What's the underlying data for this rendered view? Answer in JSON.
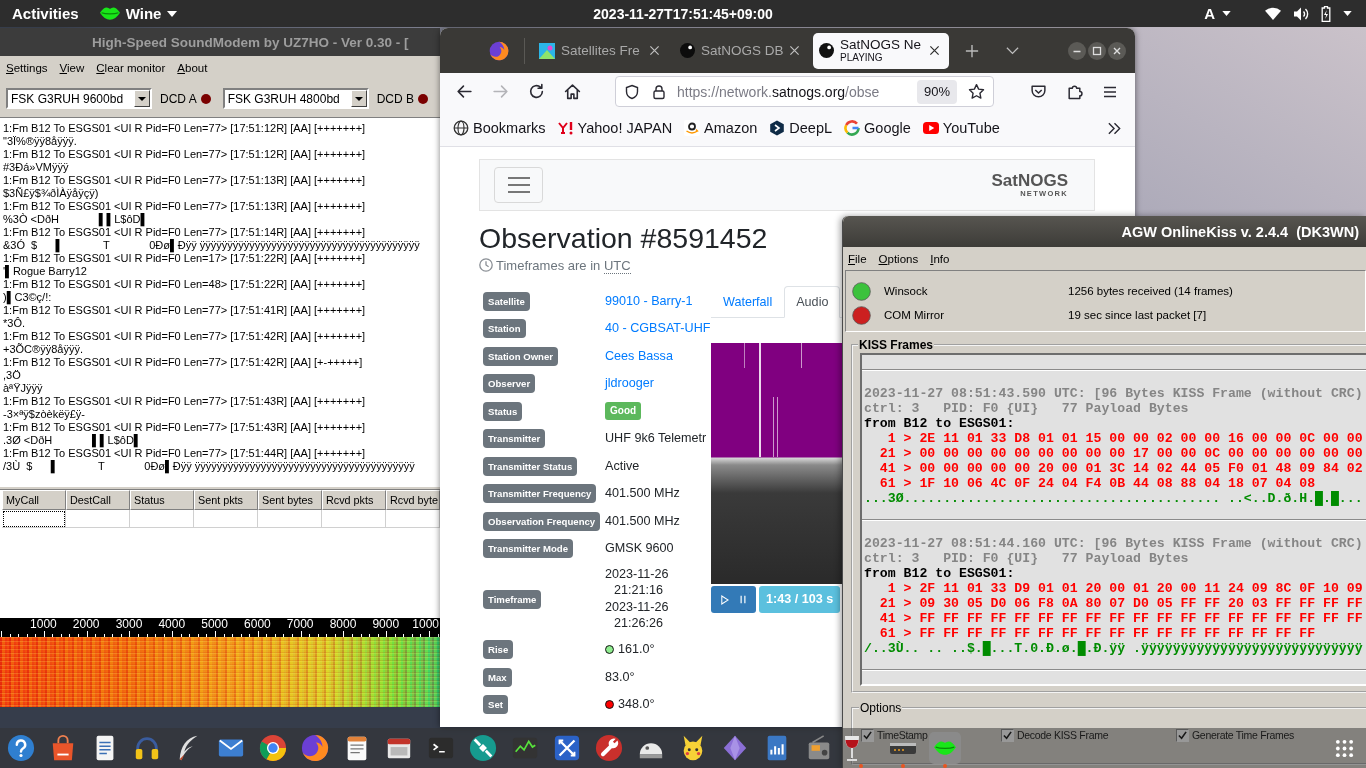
{
  "top_bar": {
    "activities": "Activities",
    "app_name": "Wine",
    "clock": "2023-11-27T17:51:45+09:00",
    "input_source": "A"
  },
  "soundmodem": {
    "title": "High-Speed SoundModem by UZ7HO - Ver 0.30 - [",
    "menu": [
      "Settings",
      "View",
      "Clear monitor",
      "About"
    ],
    "channels": [
      {
        "mode": "FSK G3RUH 9600bd",
        "dcd_label": "DCD A"
      },
      {
        "mode": "FSK G3RUH 4800bd",
        "dcd_label": "DCD B"
      }
    ],
    "monitor_lines": [
      "1:Fm B12 To ESGS01 <UI R Pid=F0 Len=77> [17:51:12R] [AA] [+++++++]",
      "\"3Ï%®ÿÿ8åÿÿÿ.",
      "1:Fm B12 To ESGS01 <UI R Pid=F0 Len=77> [17:51:12R] [AA] [+++++++]",
      "#3Ðá»VMÿÿÿ",
      "1:Fm B12 To ESGS01 <UI R Pid=F0 Len=77> [17:51:13R] [AA] [+++++++]",
      "$3Ñ£ÿ$¾ðÌÀÿåÿçÿ)",
      "1:Fm B12 To ESGS01 <UI R Pid=F0 Len=77> [17:51:13R] [AA] [+++++++]",
      "%3Ò <DðH             ▌▌L$ôD▌",
      "1:Fm B12 To ESGS01 <UI R Pid=F0 Len=77> [17:51:14R] [AA] [+++++++]",
      "&3Ó  $      ▌             T             0Ðø▌Ðÿÿ ÿÿÿÿÿÿÿÿÿÿÿÿÿÿÿÿÿÿÿÿÿÿÿÿÿÿÿÿÿÿÿÿÿÿÿÿÿÿÿÿ",
      "1:Fm B12 To ESGS01 <UI R Pid=F0 Len=17> [17:51:22R] [AA] [+++++++]",
      "'▌Rogue Barry12",
      "1:Fm B12 To ESGS01 <UI R Pid=F0 Len=48> [17:51:22R] [AA] [+++++++]",
      ")▌C3©ç/!:",
      "1:Fm B12 To ESGS01 <UI R Pid=F0 Len=77> [17:51:41R] [AA] [+++++++]",
      "*3Ô.",
      "1:Fm B12 To ESGS01 <UI R Pid=F0 Len=77> [17:51:42R] [AA] [+++++++]",
      "+3ÕC®ÿÿ8åÿÿÿ.",
      "1:Fm B12 To ESGS01 <UI R Pid=F0 Len=77> [17:51:42R] [AA] [+-+++++]",
      ",3Ö",
      "àªŸJÿÿÿ",
      "1:Fm B12 To ESGS01 <UI R Pid=F0 Len=77> [17:51:43R] [AA] [+++++++]",
      "-3×ªÿ$zòèkëÿ£ÿ-",
      "1:Fm B12 To ESGS01 <UI R Pid=F0 Len=77> [17:51:43R] [AA] [+++++++]",
      ".3Ø <DðH             ▌▌L$ôD▌",
      "1:Fm B12 To ESGS01 <UI R Pid=F0 Len=77> [17:51:44R] [AA] [+++++++]",
      "/3Ù  $      ▌             T             0Ðø▌Ðÿÿ ÿÿÿÿÿÿÿÿÿÿÿÿÿÿÿÿÿÿÿÿÿÿÿÿÿÿÿÿÿÿÿÿÿÿÿÿÿÿÿÿ"
    ],
    "table": {
      "columns": [
        {
          "label": "MyCall",
          "focused": true
        },
        {
          "label": "DestCall",
          "focused": false
        },
        {
          "label": "Status",
          "focused": false
        },
        {
          "label": "Sent pkts",
          "focused": false
        },
        {
          "label": "Sent bytes",
          "focused": false
        },
        {
          "label": "Rcvd pkts",
          "focused": false
        },
        {
          "label": "Rcvd byte",
          "focused": false
        }
      ]
    },
    "waterfall_scale": [
      "1000",
      "2000",
      "3000",
      "4000",
      "5000",
      "6000",
      "7000",
      "8000",
      "9000",
      "1000"
    ]
  },
  "browser": {
    "tabs": [
      {
        "title": "Satellites Fre",
        "selected": false
      },
      {
        "title": "SatNOGS DB",
        "selected": false
      },
      {
        "title": "SatNOGS Ne",
        "subtitle": "PLAYING",
        "selected": true
      }
    ],
    "nav_buttons": [
      {
        "disabled": false
      },
      {
        "disabled": true
      },
      {
        "disabled": false
      },
      {
        "disabled": false
      }
    ],
    "url": {
      "prefix": "https://network.",
      "domain": "satnogs.org",
      "suffix": "/obse"
    },
    "zoom": "90%",
    "bookmarks": [
      "Bookmarks",
      "Yahoo! JAPAN",
      "Amazon",
      "DeepL",
      "Google",
      "YouTube"
    ],
    "page": {
      "logo": {
        "name": "SatNOGS",
        "sub": "NETWORK"
      },
      "title": "Observation #8591452",
      "tz_note": "Timeframes are in ",
      "tz": "UTC",
      "details": [
        {
          "label": "Satellite",
          "kind": "link",
          "value": "99010 - Barry-1"
        },
        {
          "label": "Station",
          "kind": "link",
          "value": "40 - CGBSAT-UHF"
        },
        {
          "label": "Station Owner",
          "kind": "link",
          "value": "Cees Bassa"
        },
        {
          "label": "Observer",
          "kind": "link",
          "value": "jldrooger"
        },
        {
          "label": "Status",
          "kind": "badge",
          "value": "Good"
        },
        {
          "label": "Transmitter",
          "kind": "text",
          "value": "UHF 9k6 Telemetr"
        },
        {
          "label": "Transmitter Status",
          "kind": "text",
          "value": "Active"
        },
        {
          "label": "Transmitter Frequency",
          "kind": "text",
          "value": "401.500 MHz"
        },
        {
          "label": "Observation Frequency",
          "kind": "text",
          "value": "401.500 MHz"
        },
        {
          "label": "Transmitter Mode",
          "kind": "text",
          "value": "GMSK 9600"
        },
        {
          "label": "Timeframe",
          "kind": "lines",
          "values": [
            "2023-11-26 21:21:16",
            "2023-11-26 21:26:26"
          ]
        },
        {
          "label": "Rise",
          "kind": "dot",
          "color": "#90ee90",
          "value": "161.0°"
        },
        {
          "label": "Max",
          "kind": "text",
          "value": "83.0°"
        },
        {
          "label": "Set",
          "kind": "dot",
          "color": "#ff0000",
          "value": "348.0°"
        }
      ],
      "media_tabs": [
        {
          "label": "Waterfall",
          "selected": false
        },
        {
          "label": "Audio",
          "selected": true
        }
      ],
      "player": {
        "time": "1:43 / 103 s"
      }
    }
  },
  "agw": {
    "title": "AGW OnlineKiss v. 2.4.4  (DK3WN)",
    "menu": [
      "File",
      "Options",
      "Info"
    ],
    "connections": [
      {
        "name": "Winsock",
        "info": "1256 bytes received (14 frames)",
        "color": "#3cc23c"
      },
      {
        "name": "COM Mirror",
        "info": "19 sec since last packet [7]",
        "color": "#cc2020"
      }
    ],
    "frames_title": "KISS Frames",
    "frames": [
      {
        "header": "2023-11-27 08:51:43.590 UTC: [96 Bytes KISS Frame (without CRC)",
        "info": "ctrl: 3   PID: F0 {UI}   77 Payload Bytes",
        "route": "from B12 to ESGS01:",
        "hex_lines": [
          "   1 > 2E 11 01 33 D8 01 01 15 00 00 02 00 00 16 00 00 0C 00 00",
          "  21 > 00 00 00 00 00 00 00 00 00 17 00 00 0C 00 00 00 00 00 00",
          "  41 > 00 00 00 00 00 20 00 01 3C 14 02 44 05 F0 01 48 09 84 02",
          "  61 > 1F 10 06 4C 0F 24 04 F4 0B 44 08 88 04 18 07 04 08"
        ],
        "ascii": "...3Ø........................................ ..<..D.ð.H.█.█..."
      },
      {
        "header": "2023-11-27 08:51:44.160 UTC: [96 Bytes KISS Frame (without CRC)",
        "info": "ctrl: 3   PID: F0 {UI}   77 Payload Bytes",
        "route": "from B12 to ESGS01:",
        "hex_lines": [
          "   1 > 2F 11 01 33 D9 01 01 20 00 01 20 00 11 24 09 8C 0F 10 09",
          "  21 > 09 30 05 D0 06 F8 0A 80 07 D0 05 FF FF 20 03 FF FF FF FF",
          "  41 > FF FF FF FF FF FF FF FF FF FF FF FF FF FF FF FF FF FF FF",
          "  61 > FF FF FF FF FF FF FF FF FF FF FF FF FF FF FF FF FF"
        ],
        "ascii": "/..3Ù.. .. ..$.█...T.0.Ð.ø.█.Ð.ÿÿ .ÿÿÿÿÿÿÿÿÿÿÿÿÿÿÿÿÿÿÿÿÿÿÿÿÿÿÿÿ"
      }
    ],
    "options_title": "Options",
    "options": [
      {
        "label": "TimeStamp",
        "checked": true
      },
      {
        "label": "Decode KISS Frame",
        "checked": true
      },
      {
        "label": "Generate Time Frames",
        "checked": true
      }
    ]
  },
  "dock": {
    "items": [
      {
        "selected": false,
        "running": false
      },
      {
        "selected": false,
        "running": false
      },
      {
        "selected": false,
        "running": false
      },
      {
        "selected": false,
        "running": false
      },
      {
        "selected": false,
        "running": false
      },
      {
        "selected": false,
        "running": false
      },
      {
        "selected": false,
        "running": false
      },
      {
        "selected": false,
        "running": false
      },
      {
        "selected": false,
        "running": false
      },
      {
        "selected": false,
        "running": false
      },
      {
        "selected": false,
        "running": false
      },
      {
        "selected": false,
        "running": false
      },
      {
        "selected": false,
        "running": false
      },
      {
        "selected": false,
        "running": false
      },
      {
        "selected": false,
        "running": false
      },
      {
        "selected": false,
        "running": false
      },
      {
        "selected": false,
        "running": false
      },
      {
        "selected": false,
        "running": false
      },
      {
        "selected": false,
        "running": false
      },
      {
        "selected": false,
        "running": false
      },
      {
        "selected": false,
        "running": true
      },
      {
        "selected": false,
        "running": true
      },
      {
        "selected": true,
        "running": true
      }
    ]
  }
}
